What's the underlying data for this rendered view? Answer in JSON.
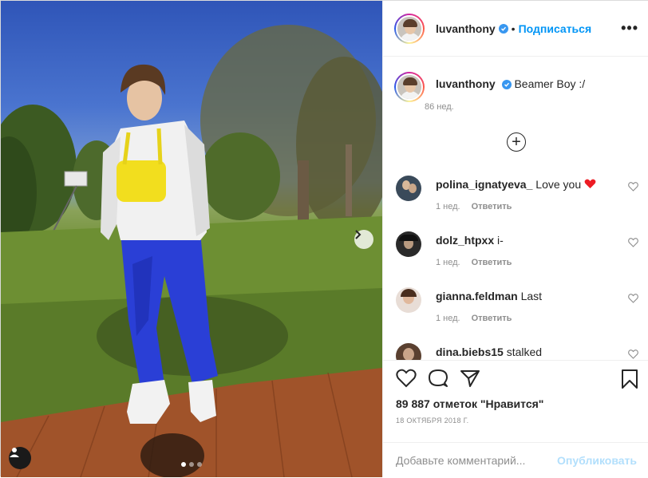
{
  "post": {
    "username": "luvanthony",
    "follow_label": "Подписаться",
    "separator": "•",
    "more_label": "•••",
    "caption": {
      "username": "luvanthony",
      "text": "Beamer Boy :/",
      "time": "86 нед."
    },
    "load_more_label": "+",
    "comments": [
      {
        "username": "polina_ignatyeva_",
        "text": "Love you",
        "emoji": "heart",
        "time": "1 нед.",
        "reply": "Ответить",
        "avatar_color": "#3a4a5a"
      },
      {
        "username": "dolz_htpxx",
        "text": "i-",
        "time": "1 нед.",
        "reply": "Ответить",
        "avatar_color": "#2a2a2a"
      },
      {
        "username": "gianna.feldman",
        "text": "Last",
        "time": "1 нед.",
        "reply": "Ответить",
        "avatar_color": "#d9c8c0"
      },
      {
        "username": "dina.biebs15",
        "text": "stalked",
        "avatar_color": "#5a4030"
      }
    ],
    "likes": "89 887 отметок \"Нравится\"",
    "date": "18 ОКТЯБРЯ 2018 Г.",
    "comment_placeholder": "Добавьте комментарий...",
    "publish_label": "Опубликовать",
    "carousel": {
      "count": 3,
      "active": 0
    },
    "colors": {
      "accent": "#0095f6",
      "verified": "#3897f0",
      "publish_disabled": "#b2dffc",
      "heart": "#ed4956"
    }
  }
}
